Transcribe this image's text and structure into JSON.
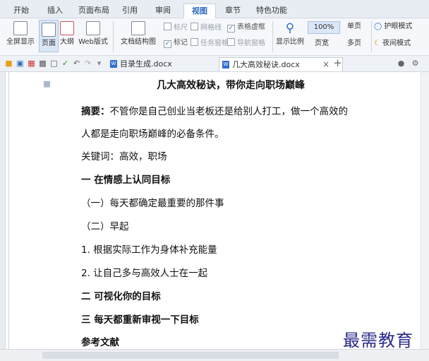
{
  "menu": {
    "tabs": [
      "开始",
      "插入",
      "页面布局",
      "引用",
      "审阅",
      "视图",
      "章节",
      "特色功能"
    ],
    "active_tab": "视图"
  },
  "ribbon": {
    "fullscreen": "全屏显示",
    "page_view": "页面",
    "outline": "大纲",
    "web_view": "Web版式",
    "doc_structure": "文档结构图",
    "ruler": "标尺",
    "gridlines": "网格线",
    "table_gridlines": "表格虚框",
    "marks": "标记",
    "task_pane": "任务窗格",
    "nav_pane": "导航窗格",
    "zoom": "显示比例",
    "zoom_value": "100%",
    "page_width": "页宽",
    "single_page": "单页",
    "multi_page": "多页",
    "eye_mode": "护眼模式",
    "night_mode": "夜间模式"
  },
  "tabs": {
    "doc1": "目录生成.docx",
    "doc2": "几大高效秘诀.docx",
    "doc_icon": "W"
  },
  "document": {
    "title": "几大高效秘诀，带你走向职场巅峰",
    "abstract_label": "摘要：",
    "abstract_line1": "不管你是自己创业当老板还是给别人打工，做一个高效的",
    "abstract_line2": "人都是走向职场巅峰的必备条件。",
    "keywords": "关键词：高效，职场",
    "h1": "一  在情感上认同目标",
    "h1_1": "（一）每天都确定最重要的那件事",
    "h1_2": "（二）早起",
    "p1": "1. 根据实际工作为身体补充能量",
    "p2": "2. 让自己多与高效人士在一起",
    "h2": "二  可视化你的目标",
    "h3": "三  每天都重新审视一下目标",
    "refs": "参考文献"
  },
  "watermark": "最需教育"
}
